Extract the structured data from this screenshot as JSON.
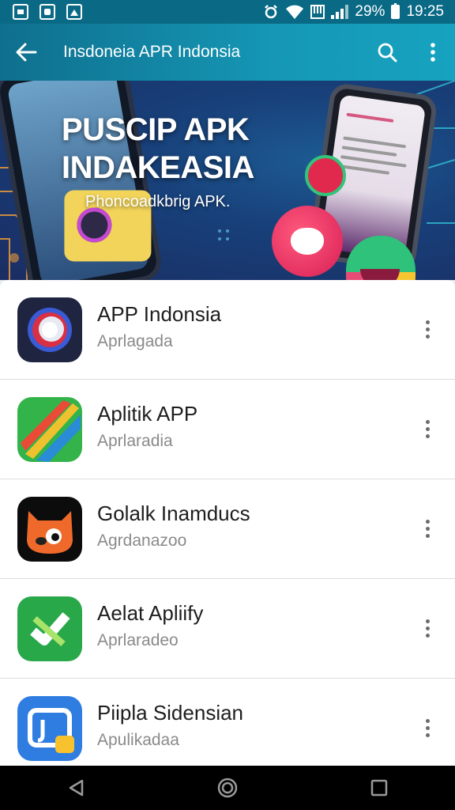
{
  "status_bar": {
    "battery": "29%",
    "time": "19:25"
  },
  "app_bar": {
    "title": "Insdoneia APR Indonsia"
  },
  "banner": {
    "headline_line1": "PUSCIP APK",
    "headline_line2": "INDAKEASIA",
    "tagline": "Phoncoadkbrig APK."
  },
  "apps": [
    {
      "title": "APP Indonsia",
      "subtitle": "Aprlagada",
      "icon": "app-indonsia-icon"
    },
    {
      "title": "Aplitik APP",
      "subtitle": "Aprlaradia",
      "icon": "aplitik-app-icon"
    },
    {
      "title": "Golalk Inamducs",
      "subtitle": "Agrdanazoo",
      "icon": "golalk-inamducs-icon"
    },
    {
      "title": "Aelat Apliify",
      "subtitle": "Aprlaradeo",
      "icon": "aelat-apliify-icon"
    },
    {
      "title": "Piipla Sidensian",
      "subtitle": "Apulikadaa",
      "icon": "piipla-sidensian-icon"
    }
  ],
  "colors": {
    "app_bar": "#1597b5",
    "status_bar": "#0a6a86",
    "nav_bar": "#000000"
  }
}
